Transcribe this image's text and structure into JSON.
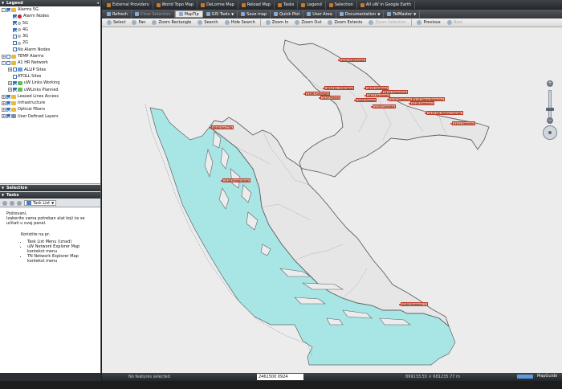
{
  "legend": {
    "title": "Legend",
    "items": [
      {
        "label": "Alarms 5G",
        "level": 0,
        "expander": "-",
        "checked": true,
        "icon": "folder"
      },
      {
        "label": "Alarm Nodes",
        "level": 1,
        "expander": "",
        "checked": true,
        "icon": "red-dot"
      },
      {
        "label": "5G",
        "level": 1,
        "expander": "",
        "checked": true,
        "icon": "gray-dot"
      },
      {
        "label": "4G",
        "level": 1,
        "expander": "",
        "checked": true,
        "icon": "gray-dot"
      },
      {
        "label": "3G",
        "level": 1,
        "expander": "",
        "checked": false,
        "icon": "gray-dot"
      },
      {
        "label": "2G",
        "level": 1,
        "expander": "",
        "checked": false,
        "icon": "gray-dot"
      },
      {
        "label": "No Alarm Nodes",
        "level": 1,
        "expander": "",
        "checked": false,
        "icon": "none"
      },
      {
        "label": "TEMP Alarms",
        "level": 0,
        "expander": "+",
        "checked": false,
        "icon": "folder"
      },
      {
        "label": "A1 HR Network",
        "level": 0,
        "expander": "-",
        "checked": false,
        "icon": "folder"
      },
      {
        "label": "ALLIP Sites",
        "level": 1,
        "expander": "+",
        "checked": false,
        "icon": "network"
      },
      {
        "label": "ATOLL Sites",
        "level": 1,
        "expander": "",
        "checked": false,
        "icon": "none"
      },
      {
        "label": "uW Links Working",
        "level": 1,
        "expander": "+",
        "checked": true,
        "icon": "link"
      },
      {
        "label": "uWLinks Planned",
        "level": 1,
        "expander": "+",
        "checked": true,
        "icon": "link"
      },
      {
        "label": "Leased Lines Access",
        "level": 0,
        "expander": "+",
        "checked": true,
        "icon": "folder"
      },
      {
        "label": "Infrastructure",
        "level": 0,
        "expander": "+",
        "checked": true,
        "icon": "folder"
      },
      {
        "label": "Optical Fibers",
        "level": 0,
        "expander": "+",
        "checked": true,
        "icon": "folder"
      },
      {
        "label": "User Defined Layers",
        "level": 0,
        "expander": "+",
        "checked": true,
        "icon": "layers"
      }
    ]
  },
  "selection": {
    "title": "Selection"
  },
  "tasks": {
    "title": "Tasks",
    "select_label": "Task List",
    "greeting": "Poštovani,",
    "intro": "Izaberite vama potreban alat koji će se učitati u ovaj panel.",
    "sub": "Koristite na pr.",
    "options": [
      "Task List Menu (iznad)",
      "uW Network Explorer Map kontekst menu",
      "TN Network Explorer Map kontekst menu"
    ]
  },
  "toolbar1": [
    {
      "label": "External Providers"
    },
    {
      "label": "World Topo Map"
    },
    {
      "label": "DeLorme Map"
    },
    {
      "label": "Reload Map"
    },
    {
      "label": "Tasks"
    },
    {
      "label": "Legend"
    },
    {
      "label": "Selection"
    },
    {
      "label": "All uW in Google Earth"
    }
  ],
  "toolbar2": [
    {
      "label": "Refresh",
      "state": "normal",
      "dropdown": false
    },
    {
      "label": "Clear Selection",
      "state": "dim",
      "dropdown": false
    },
    {
      "label": "MapTip",
      "state": "active",
      "dropdown": false
    },
    {
      "label": "GIS Tools",
      "state": "normal",
      "dropdown": true
    },
    {
      "label": "Save map",
      "state": "normal",
      "dropdown": false
    },
    {
      "label": "Quick Plot",
      "state": "normal",
      "dropdown": false
    },
    {
      "label": "User Area",
      "state": "normal",
      "dropdown": false
    },
    {
      "label": "Documentation",
      "state": "normal",
      "dropdown": true
    },
    {
      "label": "TelMaster",
      "state": "normal",
      "dropdown": true
    }
  ],
  "toolbar3": [
    {
      "label": "Select",
      "state": "normal"
    },
    {
      "label": "Pan",
      "state": "normal"
    },
    {
      "label": "Zoom Rectangle",
      "state": "normal"
    },
    {
      "label": "Search",
      "state": "normal"
    },
    {
      "label": "Hide Search",
      "state": "normal"
    },
    {
      "label": "Zoom In",
      "state": "normal"
    },
    {
      "label": "Zoom Out",
      "state": "normal"
    },
    {
      "label": "Zoom Extents",
      "state": "normal"
    },
    {
      "label": "Zoom Selection",
      "state": "dim"
    },
    {
      "label": "Previous",
      "state": "normal"
    },
    {
      "label": "Next",
      "state": "dim"
    }
  ],
  "map": {
    "colors": {
      "sea": "#a8e6e6",
      "land": "#ebebeb",
      "border": "#606060",
      "site_fill": "#f2a184",
      "site_border": "#c0392b"
    },
    "sites": [
      {
        "label": "1447 KRATOVAC"
      },
      {
        "label": "1619 BI_CON Salaj"
      },
      {
        "label": "1423 Grdevac"
      },
      {
        "label": "1415 Zvonarica"
      },
      {
        "label": "0186 Šumetani"
      },
      {
        "label": "1127 Plitice"
      },
      {
        "label": "1417 Pavlovec"
      },
      {
        "label": "0273 VT Nova Bukovica"
      },
      {
        "label": "1137 Brekovci"
      },
      {
        "label": "1580 Bastaji"
      },
      {
        "label": "0128 Brekovci"
      },
      {
        "label": "1133 Caraljka"
      },
      {
        "label": "1137 DS Našice Centar"
      },
      {
        "label": "3111 Semeljci"
      },
      {
        "label": "0640 Ika CTN"
      },
      {
        "label": "1128 Punta Kriza"
      },
      {
        "label": "4369 Metković 2"
      }
    ]
  },
  "status": {
    "features": "No features selected",
    "coordinate_input": "2461500 0924",
    "xy": "899133.55 × 681235.77 m",
    "brand": "MapGuide"
  }
}
